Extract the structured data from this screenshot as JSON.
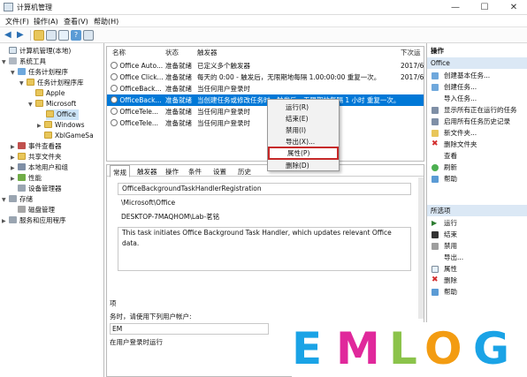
{
  "window": {
    "title": "计算机管理",
    "minimize": "—",
    "maximize": "☐",
    "close": "✕"
  },
  "menu": [
    "文件(F)",
    "操作(A)",
    "查看(V)",
    "帮助(H)"
  ],
  "tree": [
    {
      "label": "计算机管理(本地)",
      "arrow": ""
    },
    {
      "label": "系统工具",
      "arrow": "▼"
    },
    {
      "label": "任务计划程序",
      "arrow": "▼"
    },
    {
      "label": "任务计划程序库",
      "arrow": "▼"
    },
    {
      "label": "Apple",
      "arrow": ""
    },
    {
      "label": "Microsoft",
      "arrow": "▼"
    },
    {
      "label": "Office",
      "arrow": ""
    },
    {
      "label": "Windows",
      "arrow": "▶"
    },
    {
      "label": "XblGameSa",
      "arrow": ""
    },
    {
      "label": "事件查看器",
      "arrow": "▶"
    },
    {
      "label": "共享文件夹",
      "arrow": "▶"
    },
    {
      "label": "本地用户和组",
      "arrow": "▶"
    },
    {
      "label": "性能",
      "arrow": "▶"
    },
    {
      "label": "设备管理器",
      "arrow": ""
    },
    {
      "label": "存储",
      "arrow": "▼"
    },
    {
      "label": "磁盘管理",
      "arrow": ""
    },
    {
      "label": "服务和应用程序",
      "arrow": "▶"
    }
  ],
  "tasklist": {
    "headers": [
      "名称",
      "状态",
      "触发器",
      "下次运"
    ],
    "rows": [
      {
        "name": "Office Auto...",
        "status": "准备就绪",
        "trigger": "已定义多个触发器",
        "next": "2017/6"
      },
      {
        "name": "Office Click...",
        "status": "准备就绪",
        "trigger": "每天的 0:00 - 触发后，无限期地每隔 1.00:00:00 重复一次。",
        "next": "2017/6"
      },
      {
        "name": "OfficeBack...",
        "status": "准备就绪",
        "trigger": "当任何用户登录时",
        "next": ""
      },
      {
        "name": "OfficeBack...",
        "status": "准备就绪",
        "trigger": "当创建任务或修改任务时 - 触发后，无限期地每隔 1 小时 重复一次。",
        "next": ""
      },
      {
        "name": "OfficeTele...",
        "status": "准备就绪",
        "trigger": "当任何用户登录时",
        "next": ""
      },
      {
        "name": "OfficeTele...",
        "status": "准备就绪",
        "trigger": "当任何用户登录时",
        "next": ""
      }
    ]
  },
  "context_menu": [
    "运行(R)",
    "结束(E)",
    "禁用(I)",
    "导出(X)...",
    "属性(P)",
    "删除(D)"
  ],
  "detail": {
    "tabs": [
      "常规",
      "触发器",
      "操作",
      "条件",
      "设置",
      "历史"
    ],
    "name_value": "OfficeBackgroundTaskHandlerRegistration",
    "location_value": "\\Microsoft\\Office",
    "author_value": "DESKTOP-7MAQHOM\\Lab-茗铭",
    "description_value": "This task initiates Office Background Task Handler, which updates relevant Office data.",
    "security_label": "项",
    "run_as_label": "务时，请使用下列用户帐户:",
    "run_as_value": "EM",
    "run_only_logged_on": "在用户登录时运行"
  },
  "actions": {
    "header": "操作",
    "section1": "Office",
    "items1": [
      "创建基本任务...",
      "创建任务...",
      "导入任务...",
      "显示所有正在运行的任务",
      "启用所有任务历史记录",
      "新文件夹...",
      "删除文件夹",
      "查看",
      "刷新",
      "帮助"
    ],
    "section2": "所选项",
    "items2": [
      "运行",
      "结束",
      "禁用",
      "导出...",
      "属性",
      "删除",
      "帮助"
    ]
  },
  "watermark": {
    "letters": [
      "E",
      "M",
      "L",
      "O",
      "G"
    ],
    "colors": [
      "#1aa3e6",
      "#e0289b",
      "#8bc34a",
      "#f39c12",
      "#1aa3e6"
    ]
  }
}
